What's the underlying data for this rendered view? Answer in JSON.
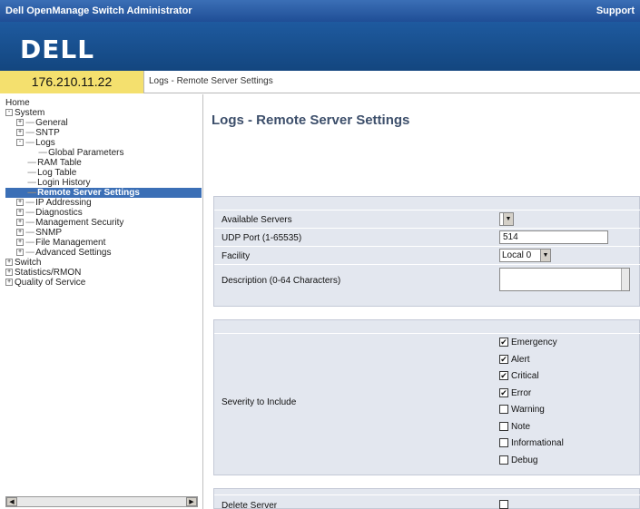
{
  "window": {
    "title": "Dell OpenManage Switch Administrator",
    "support": "Support"
  },
  "brand": {
    "logo": "DELL"
  },
  "device": {
    "ip": "176.210.11.22"
  },
  "breadcrumb": "Logs - Remote Server Settings",
  "tree": [
    {
      "label": "Home",
      "level": 0,
      "exp": "",
      "sel": false
    },
    {
      "label": "System",
      "level": 0,
      "exp": "-",
      "sel": false
    },
    {
      "label": "General",
      "level": 1,
      "exp": "+",
      "sel": false
    },
    {
      "label": "SNTP",
      "level": 1,
      "exp": "+",
      "sel": false
    },
    {
      "label": "Logs",
      "level": 1,
      "exp": "-",
      "sel": false
    },
    {
      "label": "Global Parameters",
      "level": 3,
      "exp": "",
      "sel": false
    },
    {
      "label": "RAM Table",
      "level": 2,
      "exp": "",
      "sel": false
    },
    {
      "label": "Log Table",
      "level": 2,
      "exp": "",
      "sel": false
    },
    {
      "label": "Login History",
      "level": 2,
      "exp": "",
      "sel": false
    },
    {
      "label": "Remote Server Settings",
      "level": 2,
      "exp": "",
      "sel": true
    },
    {
      "label": "IP Addressing",
      "level": 1,
      "exp": "+",
      "sel": false
    },
    {
      "label": "Diagnostics",
      "level": 1,
      "exp": "+",
      "sel": false
    },
    {
      "label": "Management Security",
      "level": 1,
      "exp": "+",
      "sel": false
    },
    {
      "label": "SNMP",
      "level": 1,
      "exp": "+",
      "sel": false
    },
    {
      "label": "File Management",
      "level": 1,
      "exp": "+",
      "sel": false
    },
    {
      "label": "Advanced Settings",
      "level": 1,
      "exp": "+",
      "sel": false
    },
    {
      "label": "Switch",
      "level": 0,
      "exp": "+",
      "sel": false
    },
    {
      "label": "Statistics/RMON",
      "level": 0,
      "exp": "+",
      "sel": false
    },
    {
      "label": "Quality of Service",
      "level": 0,
      "exp": "+",
      "sel": false
    }
  ],
  "page": {
    "title": "Logs - Remote Server Settings",
    "fields": {
      "available_servers_label": "Available Servers",
      "available_servers_value": "",
      "udp_port_label": "UDP Port (1-65535)",
      "udp_port_value": "514",
      "facility_label": "Facility",
      "facility_value": "Local 0",
      "description_label": "Description (0-64 Characters)",
      "description_value": ""
    },
    "severity_label": "Severity to Include",
    "severities": [
      {
        "label": "Emergency",
        "checked": true
      },
      {
        "label": "Alert",
        "checked": true
      },
      {
        "label": "Critical",
        "checked": true
      },
      {
        "label": "Error",
        "checked": true
      },
      {
        "label": "Warning",
        "checked": false
      },
      {
        "label": "Note",
        "checked": false
      },
      {
        "label": "Informational",
        "checked": false
      },
      {
        "label": "Debug",
        "checked": false
      }
    ],
    "delete_server_label": "Delete Server"
  },
  "colors": {
    "titlebar": "#1f4e96",
    "ip_background": "#f4e06e",
    "section_background": "#e3e7ef",
    "selected_node": "#3b6fb6"
  }
}
